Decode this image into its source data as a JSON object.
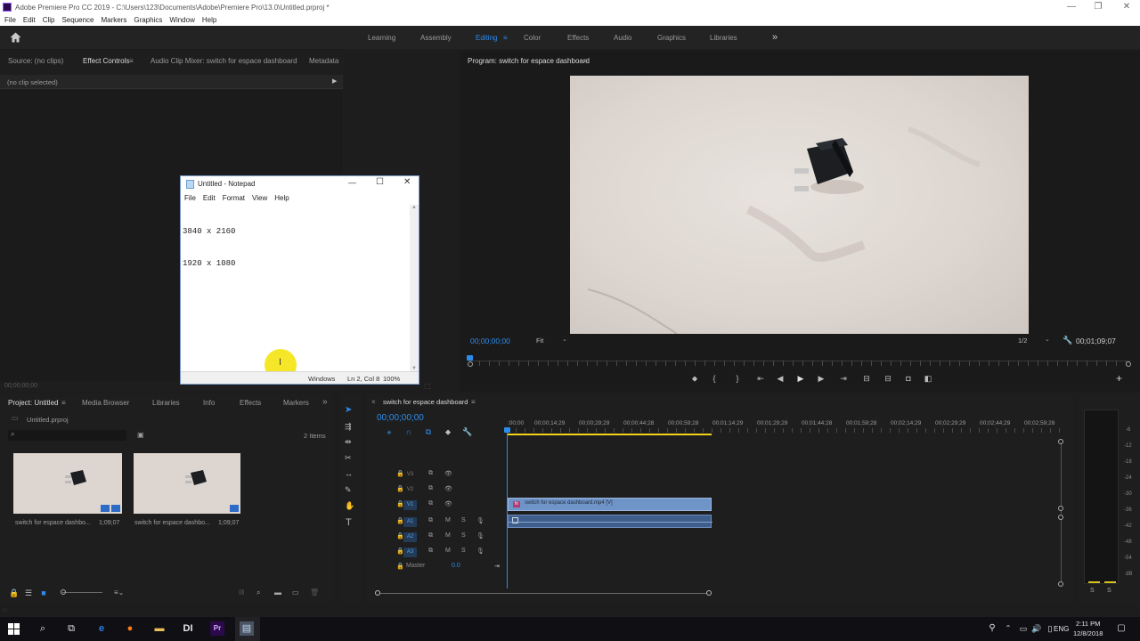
{
  "window": {
    "title": "Adobe Premiere Pro CC 2019 - C:\\Users\\123\\Documents\\Adobe\\Premiere Pro\\13.0\\Untitled.prproj *",
    "minimize": "—",
    "restore": "❐",
    "close": "✕"
  },
  "menubar": [
    "File",
    "Edit",
    "Clip",
    "Sequence",
    "Markers",
    "Graphics",
    "Window",
    "Help"
  ],
  "workspaces": {
    "items": [
      "Learning",
      "Assembly",
      "Editing",
      "Color",
      "Effects",
      "Audio",
      "Graphics",
      "Libraries"
    ],
    "active": "Editing",
    "more": "»"
  },
  "source_panel": {
    "tabs": [
      "Source: (no clips)",
      "Effect Controls",
      "Audio Clip Mixer: switch for espace dashboard",
      "Metadata"
    ],
    "active_tab": "Effect Controls",
    "no_clip": "(no clip selected)",
    "timecode": "00;00;00;00"
  },
  "program": {
    "title": "Program: switch for espace dashboard",
    "timecode": "00;00;00;00",
    "fit": "Fit",
    "resolution": "1/2",
    "duration": "00;01;09;07"
  },
  "notepad": {
    "title": "Untitled - Notepad",
    "menu": [
      "File",
      "Edit",
      "Format",
      "View",
      "Help"
    ],
    "lines": [
      "3840 x 2160",
      "1920 x 1080"
    ],
    "status": {
      "encoding": "Windows",
      "position": "Ln 2, Col 8",
      "zoom": "100%"
    }
  },
  "project": {
    "tabs": [
      "Project: Untitled",
      "Media Browser",
      "Libraries",
      "Info",
      "Effects",
      "Markers"
    ],
    "active_tab": "Project: Untitled",
    "file": "Untitled.prproj",
    "item_count": "2 Items",
    "search_placeholder": "",
    "clips": [
      {
        "name": "switch for espace dashbo...",
        "duration": "1;09;07"
      },
      {
        "name": "switch for espace dashbo...",
        "duration": "1;09;07"
      }
    ]
  },
  "timeline": {
    "sequence": "switch for espace dashboard",
    "timecode": "00;00;00;00",
    "ruler": [
      ":00;00",
      "00;00;14;29",
      "00;00;29;29",
      "00;00;44;28",
      "00;00;59;28",
      "00;01;14;29",
      "00;01;29;29",
      "00;01;44;28",
      "00;01;59;28",
      "00;02;14;29",
      "00;02;29;29",
      "00;02;44;29",
      "00;02;59;28"
    ],
    "video_tracks": [
      "V3",
      "V2",
      "V1"
    ],
    "audio_tracks": [
      "A1",
      "A2",
      "A3"
    ],
    "master": "Master",
    "master_value": "0.0",
    "clip_label": "switch for espace dashboard.mp4 [V]",
    "mute": "M",
    "solo": "S"
  },
  "meter": {
    "scale": [
      "-6",
      "-12",
      "-18",
      "-24",
      "-30",
      "-36",
      "-42",
      "-48",
      "-54",
      "dB"
    ],
    "solo": [
      "S",
      "S"
    ]
  },
  "taskbar": {
    "language": "ENG",
    "time": "2:11 PM",
    "date": "12/8/2018"
  },
  "colors": {
    "accent_blue": "#2d8ceb",
    "clip_blue": "#6f94c7",
    "playhead_yellow": "#f2d21a"
  }
}
